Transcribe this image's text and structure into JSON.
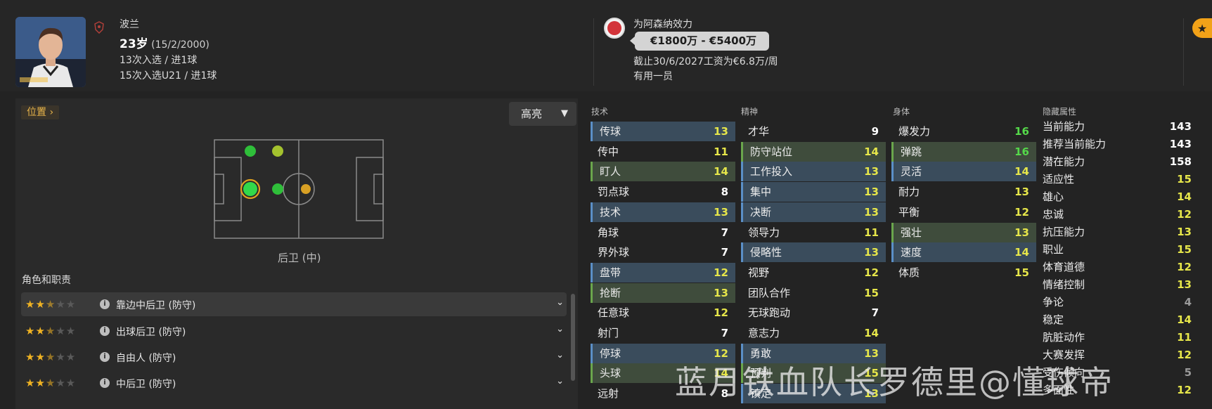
{
  "player": {
    "nation": "波兰",
    "age": "23岁",
    "dob": "(15/2/2000)",
    "caps": "13次入选 / 进1球",
    "caps_u21": "15次入选U21 / 进1球"
  },
  "club": {
    "plays_for": "为阿森纳效力",
    "value_range": "€1800万 - €5400万",
    "contract": "截止30/6/2027工资为€6.8万/周",
    "squad_status": "有用一员"
  },
  "position_panel": {
    "tag": "位置",
    "highlight_label": "高亮",
    "position_label": "后卫 (中)",
    "roles_title": "角色和职责"
  },
  "roles": [
    {
      "name": "靠边中后卫 (防守)",
      "stars": 2.5
    },
    {
      "name": "出球后卫 (防守)",
      "stars": 2.5
    },
    {
      "name": "自由人 (防守)",
      "stars": 2.5
    },
    {
      "name": "中后卫 (防守)",
      "stars": 2.5
    }
  ],
  "columns": {
    "technical": "技术",
    "mental": "精神",
    "physical": "身体",
    "hidden": "隐藏属性"
  },
  "technical": [
    {
      "name": "传球",
      "value": "13",
      "hl": "blue"
    },
    {
      "name": "传中",
      "value": "11",
      "hl": ""
    },
    {
      "name": "盯人",
      "value": "14",
      "hl": "green"
    },
    {
      "name": "罚点球",
      "value": "8",
      "hl": ""
    },
    {
      "name": "技术",
      "value": "13",
      "hl": "blue"
    },
    {
      "name": "角球",
      "value": "7",
      "hl": ""
    },
    {
      "name": "界外球",
      "value": "7",
      "hl": ""
    },
    {
      "name": "盘带",
      "value": "12",
      "hl": "blue"
    },
    {
      "name": "抢断",
      "value": "13",
      "hl": "green"
    },
    {
      "name": "任意球",
      "value": "12",
      "hl": ""
    },
    {
      "name": "射门",
      "value": "7",
      "hl": ""
    },
    {
      "name": "停球",
      "value": "12",
      "hl": "blue"
    },
    {
      "name": "头球",
      "value": "14",
      "hl": "green"
    },
    {
      "name": "远射",
      "value": "8",
      "hl": ""
    }
  ],
  "mental": [
    {
      "name": "才华",
      "value": "9",
      "hl": ""
    },
    {
      "name": "防守站位",
      "value": "14",
      "hl": "green"
    },
    {
      "name": "工作投入",
      "value": "13",
      "hl": "blue"
    },
    {
      "name": "集中",
      "value": "13",
      "hl": "blue"
    },
    {
      "name": "决断",
      "value": "13",
      "hl": "blue"
    },
    {
      "name": "领导力",
      "value": "11",
      "hl": ""
    },
    {
      "name": "侵略性",
      "value": "13",
      "hl": "blue"
    },
    {
      "name": "视野",
      "value": "12",
      "hl": ""
    },
    {
      "name": "团队合作",
      "value": "15",
      "hl": ""
    },
    {
      "name": "无球跑动",
      "value": "7",
      "hl": ""
    },
    {
      "name": "意志力",
      "value": "14",
      "hl": ""
    },
    {
      "name": "勇敢",
      "value": "13",
      "hl": "blue"
    },
    {
      "name": "预判",
      "value": "15",
      "hl": "green"
    },
    {
      "name": "镇定",
      "value": "13",
      "hl": "blue"
    }
  ],
  "physical": [
    {
      "name": "爆发力",
      "value": "16",
      "hl": ""
    },
    {
      "name": "弹跳",
      "value": "16",
      "hl": "green"
    },
    {
      "name": "灵活",
      "value": "14",
      "hl": "blue"
    },
    {
      "name": "耐力",
      "value": "13",
      "hl": ""
    },
    {
      "name": "平衡",
      "value": "12",
      "hl": ""
    },
    {
      "name": "强壮",
      "value": "13",
      "hl": "green"
    },
    {
      "name": "速度",
      "value": "14",
      "hl": "blue"
    },
    {
      "name": "体质",
      "value": "15",
      "hl": ""
    }
  ],
  "hidden": [
    {
      "name": "当前能力",
      "value": "143"
    },
    {
      "name": "推荐当前能力",
      "value": "143"
    },
    {
      "name": "潜在能力",
      "value": "158"
    },
    {
      "name": "适应性",
      "value": "15"
    },
    {
      "name": "雄心",
      "value": "14"
    },
    {
      "name": "忠诚",
      "value": "12"
    },
    {
      "name": "抗压能力",
      "value": "13"
    },
    {
      "name": "职业",
      "value": "15"
    },
    {
      "name": "体育道德",
      "value": "12"
    },
    {
      "name": "情绪控制",
      "value": "13"
    },
    {
      "name": "争论",
      "value": "4"
    },
    {
      "name": "稳定",
      "value": "14"
    },
    {
      "name": "肮脏动作",
      "value": "11"
    },
    {
      "name": "大赛发挥",
      "value": "12"
    },
    {
      "name": "受伤倾向",
      "value": "5"
    },
    {
      "name": "多面性",
      "value": "12"
    }
  ],
  "watermark": "蓝月铁血队长罗德里@懂球帝",
  "colors": {
    "accent": "#f2a218",
    "highlight_blue": "#3a4c5c",
    "highlight_green": "#3f4c3c",
    "value_green": "#55d84a",
    "value_yellow": "#e6e64a"
  }
}
